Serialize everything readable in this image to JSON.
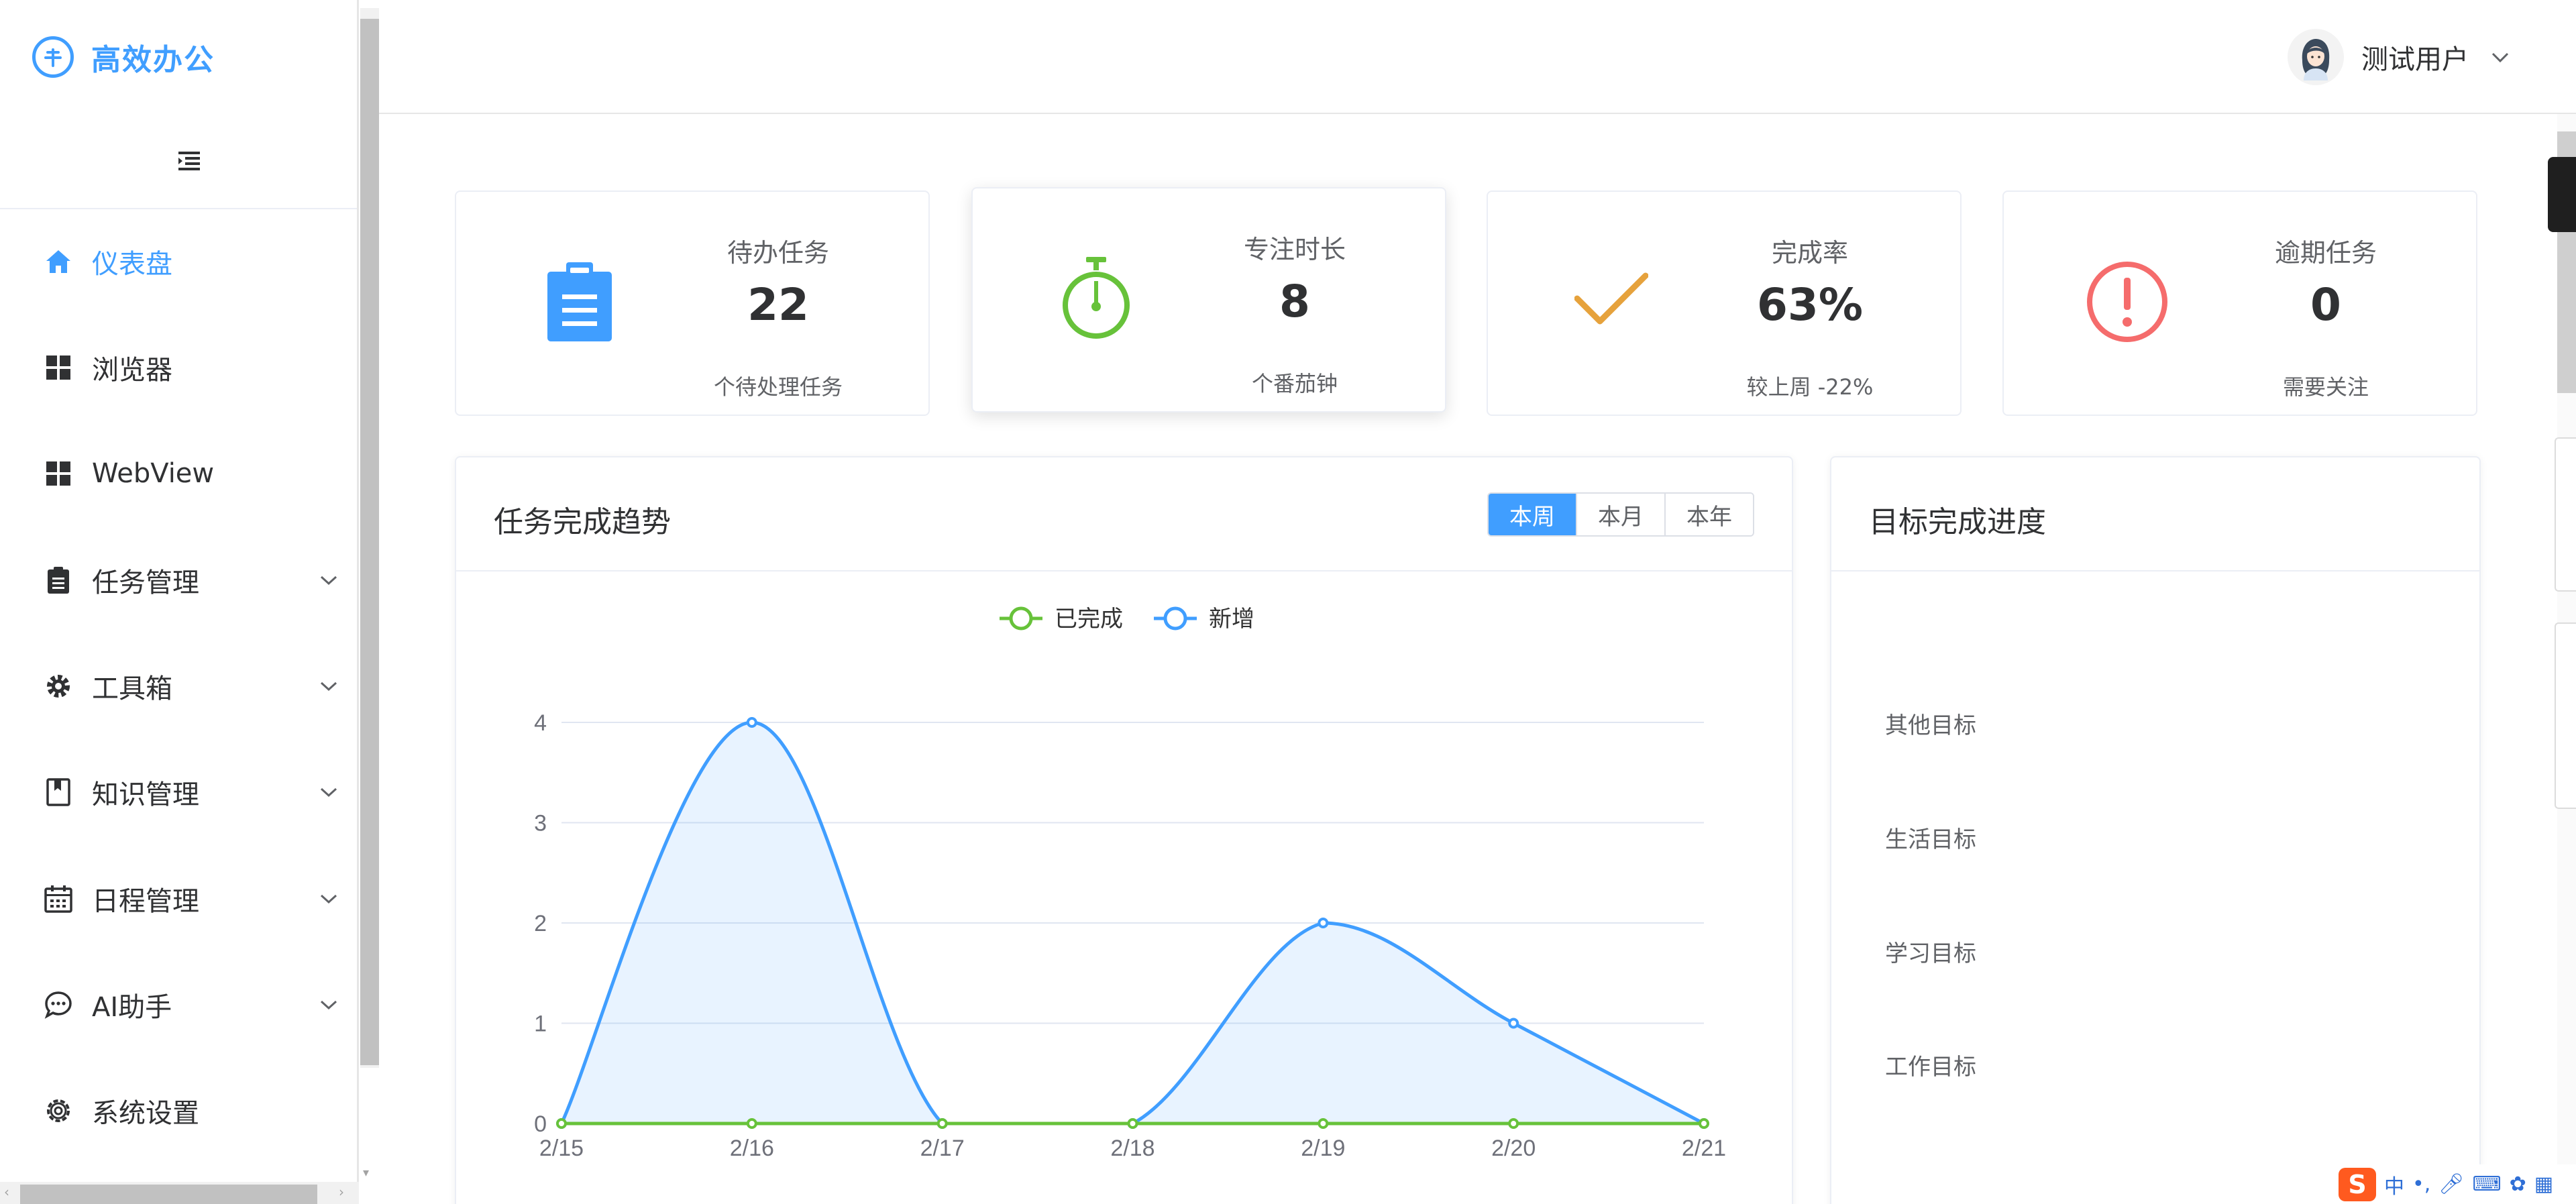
{
  "app": {
    "title": "高效办公"
  },
  "sidebar": {
    "items": [
      {
        "label": "仪表盘",
        "icon": "home-icon",
        "active": true
      },
      {
        "label": "浏览器",
        "icon": "grid-icon"
      },
      {
        "label": "WebView",
        "icon": "grid-icon"
      },
      {
        "label": "任务管理",
        "icon": "clipboard-icon",
        "expandable": true
      },
      {
        "label": "工具箱",
        "icon": "gear-icon",
        "expandable": true
      },
      {
        "label": "知识管理",
        "icon": "book-icon",
        "expandable": true
      },
      {
        "label": "日程管理",
        "icon": "calendar-icon",
        "expandable": true
      },
      {
        "label": "AI助手",
        "icon": "chat-icon",
        "expandable": true
      },
      {
        "label": "系统设置",
        "icon": "settings-icon"
      }
    ]
  },
  "header": {
    "user_name": "测试用户"
  },
  "stats": [
    {
      "title": "待办任务",
      "value": "22",
      "sub": "个待处理任务",
      "icon": "clipboard-icon",
      "color": "#409eff"
    },
    {
      "title": "专注时长",
      "value": "8",
      "sub": "个番茄钟",
      "icon": "stopwatch-icon",
      "color": "#67c23a"
    },
    {
      "title": "完成率",
      "value": "63%",
      "sub": "较上周 -22%",
      "icon": "check-icon",
      "color": "#e6a23c"
    },
    {
      "title": "逾期任务",
      "value": "0",
      "sub": "需要关注",
      "icon": "alert-icon",
      "color": "#f56c6c"
    }
  ],
  "trend_panel": {
    "title": "任务完成趋势",
    "ranges": [
      "本周",
      "本月",
      "本年"
    ],
    "active_range": "本周"
  },
  "goals_panel": {
    "title": "目标完成进度",
    "categories": [
      "其他目标",
      "生活目标",
      "学习目标",
      "工作目标"
    ]
  },
  "ime": {
    "items": [
      "中",
      "•,"
    ]
  },
  "chart_data": {
    "type": "line",
    "categories": [
      "2/15",
      "2/16",
      "2/17",
      "2/18",
      "2/19",
      "2/20",
      "2/21"
    ],
    "series": [
      {
        "name": "已完成",
        "values": [
          0,
          0,
          0,
          0,
          0,
          0,
          0
        ],
        "color": "#67c23a"
      },
      {
        "name": "新增",
        "values": [
          0,
          4,
          0,
          0,
          2,
          1,
          0
        ],
        "color": "#409eff",
        "area": true
      }
    ],
    "ylim": [
      0,
      4
    ],
    "yticks": [
      "0",
      "1",
      "2",
      "3",
      "4"
    ],
    "legend_position": "top-center",
    "grid": true
  }
}
